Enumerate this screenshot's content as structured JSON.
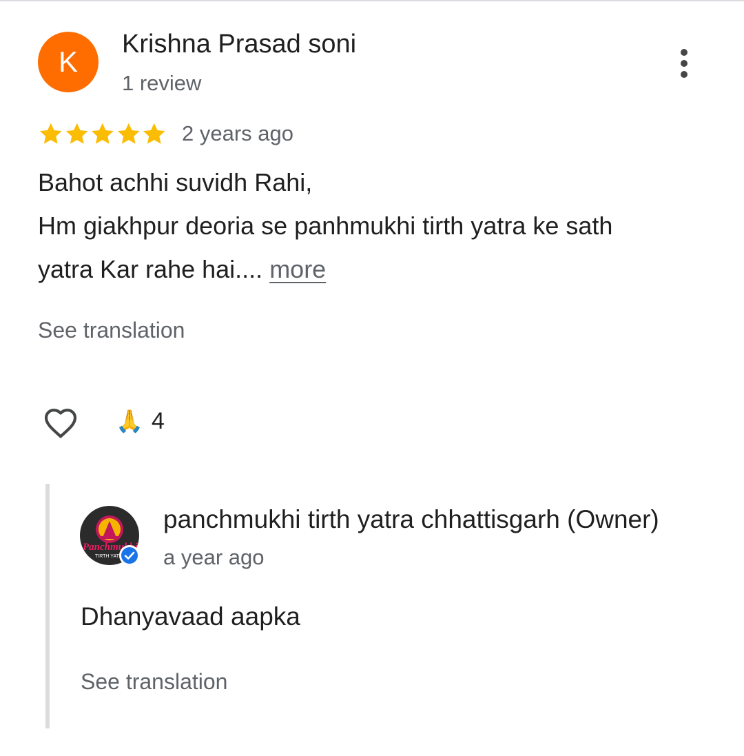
{
  "review": {
    "avatar_letter": "K",
    "avatar_color": "#ff6d00",
    "reviewer_name": "Krishna Prasad soni",
    "review_count": "1 review",
    "menu_icon": "more-vert-icon",
    "rating": 5,
    "rating_max": 5,
    "star_color": "#fbbc04",
    "time_ago": "2 years ago",
    "text_lines": [
      "Bahot achhi suvidh Rahi,",
      "Hm giakhpur deoria se panhmukhi tirth yatra ke sath",
      "yatra Kar rahe hai...."
    ],
    "more_label": "more",
    "see_translation": "See translation",
    "like_icon": "heart-outline-icon",
    "reaction_emoji": "🙏",
    "reaction_count": "4"
  },
  "reply": {
    "owner_name": "panchmukhi tirth yatra chhattisgarh (Owner)",
    "logo_text": "Panchmukhi",
    "logo_subtext": "TIRTH YATRA",
    "verified_icon": "verified-badge-icon",
    "verified_color": "#1a73e8",
    "time_ago": "a year ago",
    "text": "Dhanyavaad aapka",
    "see_translation": "See translation"
  }
}
